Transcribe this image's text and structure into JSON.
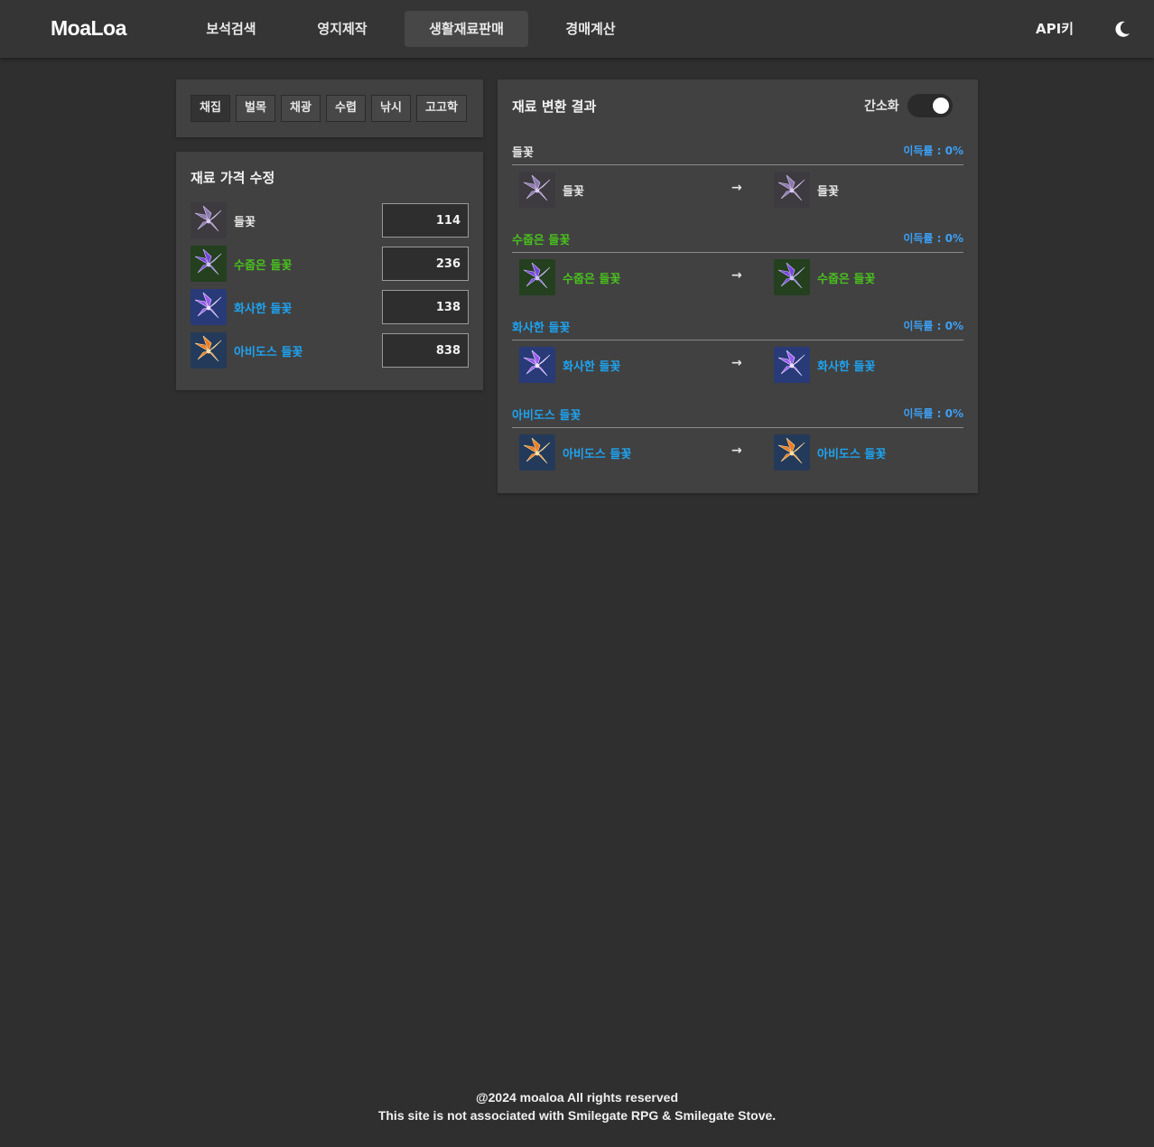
{
  "header": {
    "logo": "MoaLoa",
    "nav": [
      {
        "label": "보석검색",
        "active": false
      },
      {
        "label": "영지제작",
        "active": false
      },
      {
        "label": "생활재료판매",
        "active": true
      },
      {
        "label": "경매계산",
        "active": false
      }
    ],
    "api_key_label": "API키",
    "theme_icon": "moon-icon"
  },
  "tabs": [
    {
      "label": "채집",
      "active": true
    },
    {
      "label": "벌목",
      "active": false
    },
    {
      "label": "채광",
      "active": false
    },
    {
      "label": "수렵",
      "active": false
    },
    {
      "label": "낚시",
      "active": false
    },
    {
      "label": "고고학",
      "active": false
    }
  ],
  "price_panel": {
    "title": "재료 가격 수정",
    "items": [
      {
        "name": "들꽃",
        "price": "114",
        "color": "#e6e6e6",
        "icon": "wild-flower-icon"
      },
      {
        "name": "수줍은 들꽃",
        "price": "236",
        "color": "#49c01e",
        "icon": "shy-wild-flower-icon"
      },
      {
        "name": "화사한 들꽃",
        "price": "138",
        "color": "#1ea3f0",
        "icon": "bright-wild-flower-icon"
      },
      {
        "name": "아비도스 들꽃",
        "price": "838",
        "color": "#1ea3f0",
        "icon": "abydos-wild-flower-icon"
      }
    ]
  },
  "result_panel": {
    "title": "재료 변환 결과",
    "simplify_label": "간소화",
    "simplify_on": true,
    "groups": [
      {
        "name": "들꽃",
        "profit": "이득률 : 0%",
        "from": "들꽃",
        "to": "들꽃",
        "color": "#e6e6e6"
      },
      {
        "name": "수줍은 들꽃",
        "profit": "이득률 : 0%",
        "from": "수줍은 들꽃",
        "to": "수줍은 들꽃",
        "color": "#49c01e"
      },
      {
        "name": "화사한 들꽃",
        "profit": "이득률 : 0%",
        "from": "화사한 들꽃",
        "to": "화사한 들꽃",
        "color": "#1ea3f0"
      },
      {
        "name": "아비도스 들꽃",
        "profit": "이득률 : 0%",
        "from": "아비도스 들꽃",
        "to": "아비도스 들꽃",
        "color": "#1ea3f0"
      }
    ],
    "arrow": "→",
    "profit_color": "#3da0f5"
  },
  "footer": {
    "line1": "@2024 moaloa All rights reserved",
    "line2": "This site is not associated with Smilegate RPG & Smilegate Stove."
  }
}
